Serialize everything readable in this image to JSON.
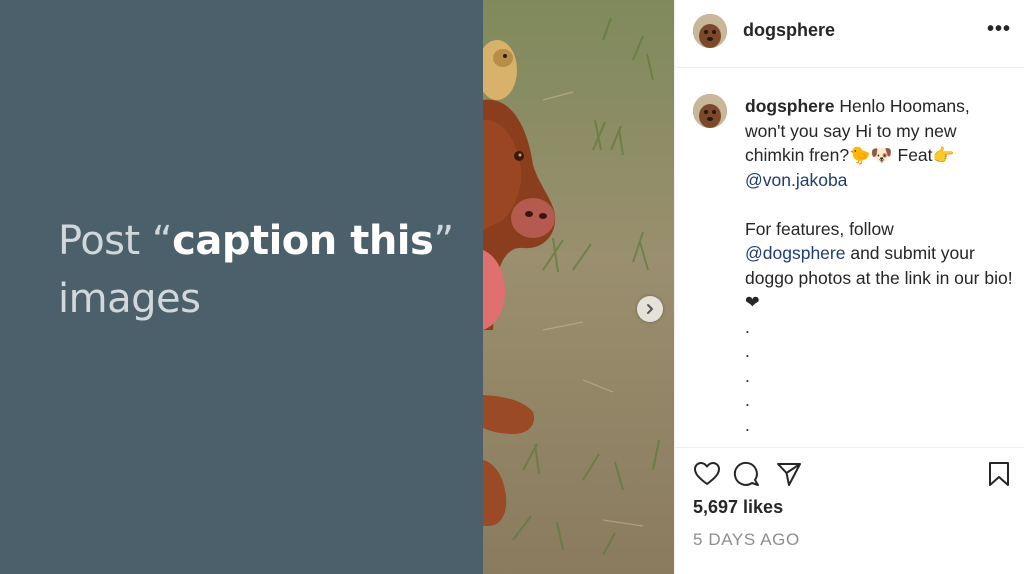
{
  "slide": {
    "title_prefix": "Post “",
    "title_bold": "caption this",
    "title_suffix": "”",
    "title_line2": "images",
    "background": "#4c606b"
  },
  "post": {
    "username": "dogsphere",
    "more_icon": "•••",
    "caption": {
      "username": "dogsphere",
      "text1": " Henlo Hoomans, won't you say Hi to my new chimkin fren?🐤🐶 Feat👉",
      "mention1": "@von.jakoba",
      "text2": "For features, follow",
      "mention2": "@dogsphere",
      "text3": " and submit your doggo photos at the link in our bio!❤",
      "dots": [
        ".",
        ".",
        ".",
        ".",
        "."
      ]
    },
    "likes": "5,697 likes",
    "time_ago": "5 DAYS AGO",
    "mention_color": "#1f3d73"
  }
}
